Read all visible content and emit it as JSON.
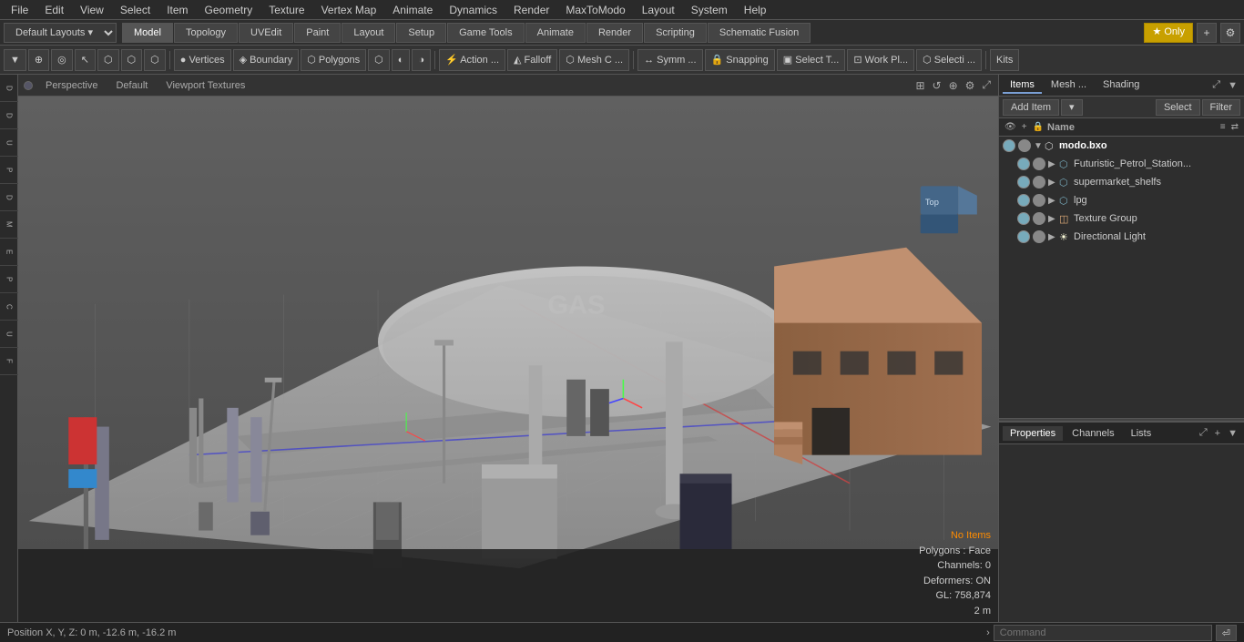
{
  "menubar": {
    "items": [
      "File",
      "Edit",
      "View",
      "Select",
      "Item",
      "Geometry",
      "Texture",
      "Vertex Map",
      "Animate",
      "Dynamics",
      "Render",
      "MaxToModo",
      "Layout",
      "System",
      "Help"
    ]
  },
  "layout_bar": {
    "dropdown_label": "Default Layouts",
    "tabs": [
      "Model",
      "Topology",
      "UVEdit",
      "Paint",
      "Layout",
      "Setup",
      "Game Tools",
      "Animate",
      "Render",
      "Scripting",
      "Schematic Fusion"
    ],
    "active_tab": "Model",
    "star_label": "★ Only",
    "plus_label": "+"
  },
  "tools_bar": {
    "items": [
      "▼",
      "⊕",
      "◎",
      "↖",
      "⬡",
      "⬡",
      "⬡",
      "Vertices",
      "Boundary",
      "Polygons",
      "⬡",
      "⬡",
      "⬡",
      "Action ...",
      "Falloff",
      "Mesh C ...",
      "Symm ...",
      "Snapping",
      "Select T...",
      "Work Pl...",
      "Selecti ...",
      "Kits"
    ]
  },
  "viewport": {
    "dot_color": "#556",
    "view_label": "Perspective",
    "layout_label": "Default",
    "texture_label": "Viewport Textures"
  },
  "viewport_status": {
    "no_items": "No Items",
    "polygons": "Polygons : Face",
    "channels": "Channels: 0",
    "deformers": "Deformers: ON",
    "gl": "GL: 758,874",
    "scale": "2 m"
  },
  "status_bar": {
    "position": "Position X, Y, Z:  0 m, -12.6 m, -16.2 m",
    "command_placeholder": "Command"
  },
  "right_panel": {
    "tabs": [
      "Items",
      "Mesh ...",
      "Shading",
      "▼"
    ],
    "active_tab": "Items",
    "toolbar": {
      "add_item_label": "Add Item",
      "select_label": "Select",
      "filter_label": "Filter"
    },
    "column_header": "Name",
    "items": [
      {
        "id": "root",
        "name": "modo.bxo",
        "indent": 0,
        "expanded": true,
        "type": "scene",
        "visible": true
      },
      {
        "id": "item1",
        "name": "Futuristic_Petrol_Station...",
        "indent": 1,
        "expanded": false,
        "type": "mesh",
        "visible": true
      },
      {
        "id": "item2",
        "name": "supermarket_shelfs",
        "indent": 1,
        "expanded": false,
        "type": "mesh",
        "visible": true
      },
      {
        "id": "item3",
        "name": "lpg",
        "indent": 1,
        "expanded": false,
        "type": "mesh",
        "visible": true
      },
      {
        "id": "item4",
        "name": "Texture Group",
        "indent": 1,
        "expanded": true,
        "type": "texture",
        "visible": true
      },
      {
        "id": "item5",
        "name": "Directional Light",
        "indent": 1,
        "expanded": false,
        "type": "light",
        "visible": true
      }
    ]
  },
  "properties_panel": {
    "tabs": [
      "Properties",
      "Channels",
      "Lists"
    ],
    "active_tab": "Properties"
  },
  "left_panel": {
    "buttons": [
      "D",
      "D",
      "U",
      "P",
      "D",
      "M",
      "E",
      "P",
      "C",
      "U",
      "F"
    ]
  }
}
